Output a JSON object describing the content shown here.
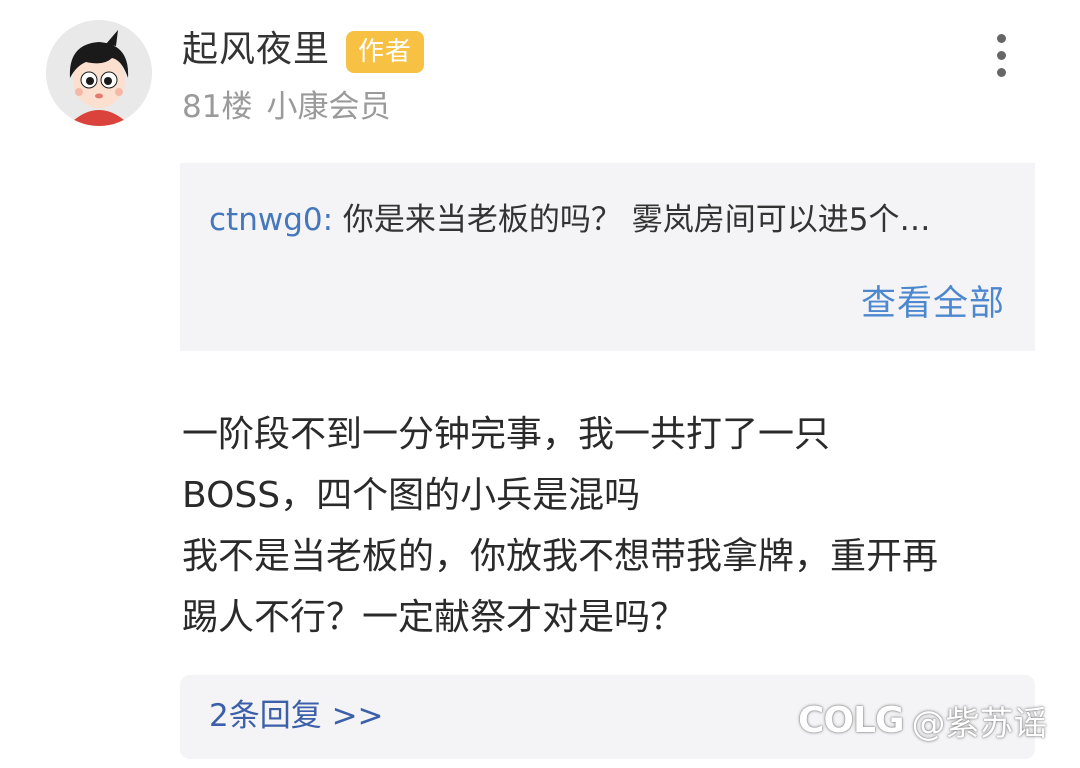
{
  "post": {
    "author": {
      "name": "起风夜里",
      "badge": "作者",
      "floor": "81楼",
      "level": "小康会员",
      "avatar": "cartoon-boy-avatar-icon"
    },
    "menu_icon": "more-vertical-icon",
    "quote": {
      "user": "ctnwg0:",
      "text": "你是来当老板的吗？  雾岚房间可以进5个…",
      "view_all": "查看全部"
    },
    "content_lines": [
      "一阶段不到一分钟完事，我一共打了一只",
      "BOSS，四个图的小兵是混吗",
      "我不是当老板的，你放我不想带我拿牌，重开再",
      "踢人不行？一定献祭才对是吗？"
    ],
    "replies_link": "2条回复 >>"
  },
  "watermark": {
    "logo": "COLG",
    "handle": "@紫苏谣"
  },
  "colors": {
    "badge": "#f7c243",
    "quote_user": "#4477bb",
    "link": "#4d88cf",
    "panel": "#f4f4f6",
    "meta_gray": "#9a9a9a"
  }
}
